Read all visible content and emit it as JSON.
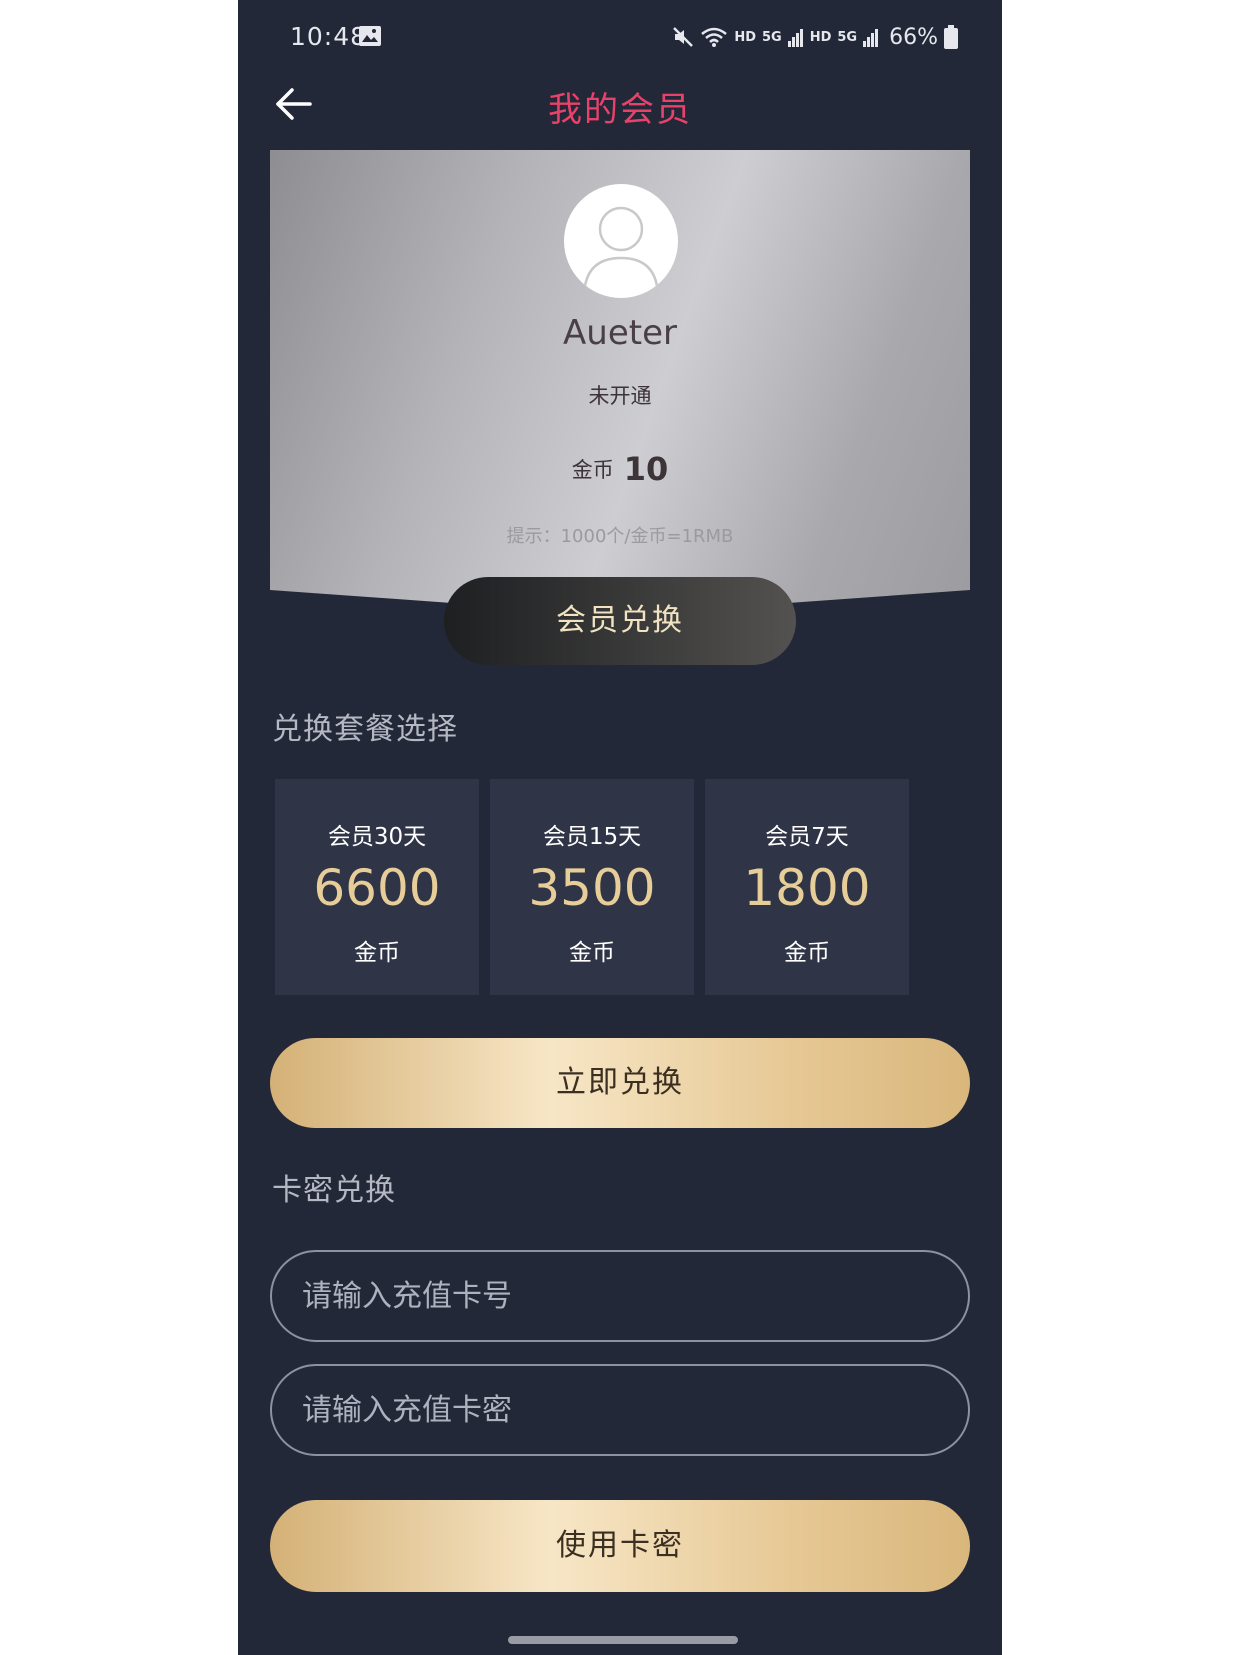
{
  "status_bar": {
    "time": "10:48",
    "hd1": "HD",
    "net1": "5G",
    "hd2": "HD",
    "net2": "5G",
    "battery": "66%"
  },
  "header": {
    "title": "我的会员"
  },
  "profile": {
    "username": "Aueter",
    "status": "未开通",
    "coin_label": "金币",
    "coin_value": "10",
    "hint": "提示：1000个/金币=1RMB"
  },
  "vip_exchange_label": "会员兑换",
  "plans_section": {
    "title": "兑换套餐选择",
    "plans": [
      {
        "name": "会员30天",
        "price": "6600",
        "unit": "金币"
      },
      {
        "name": "会员15天",
        "price": "3500",
        "unit": "金币"
      },
      {
        "name": "会员7天",
        "price": "1800",
        "unit": "金币"
      }
    ],
    "redeem_label": "立即兑换"
  },
  "card_section": {
    "title": "卡密兑换",
    "card_number_placeholder": "请输入充值卡号",
    "card_password_placeholder": "请输入充值卡密",
    "use_label": "使用卡密"
  },
  "colors": {
    "background": "#222838",
    "title": "#e8416a",
    "gold": "#e7ce99"
  }
}
